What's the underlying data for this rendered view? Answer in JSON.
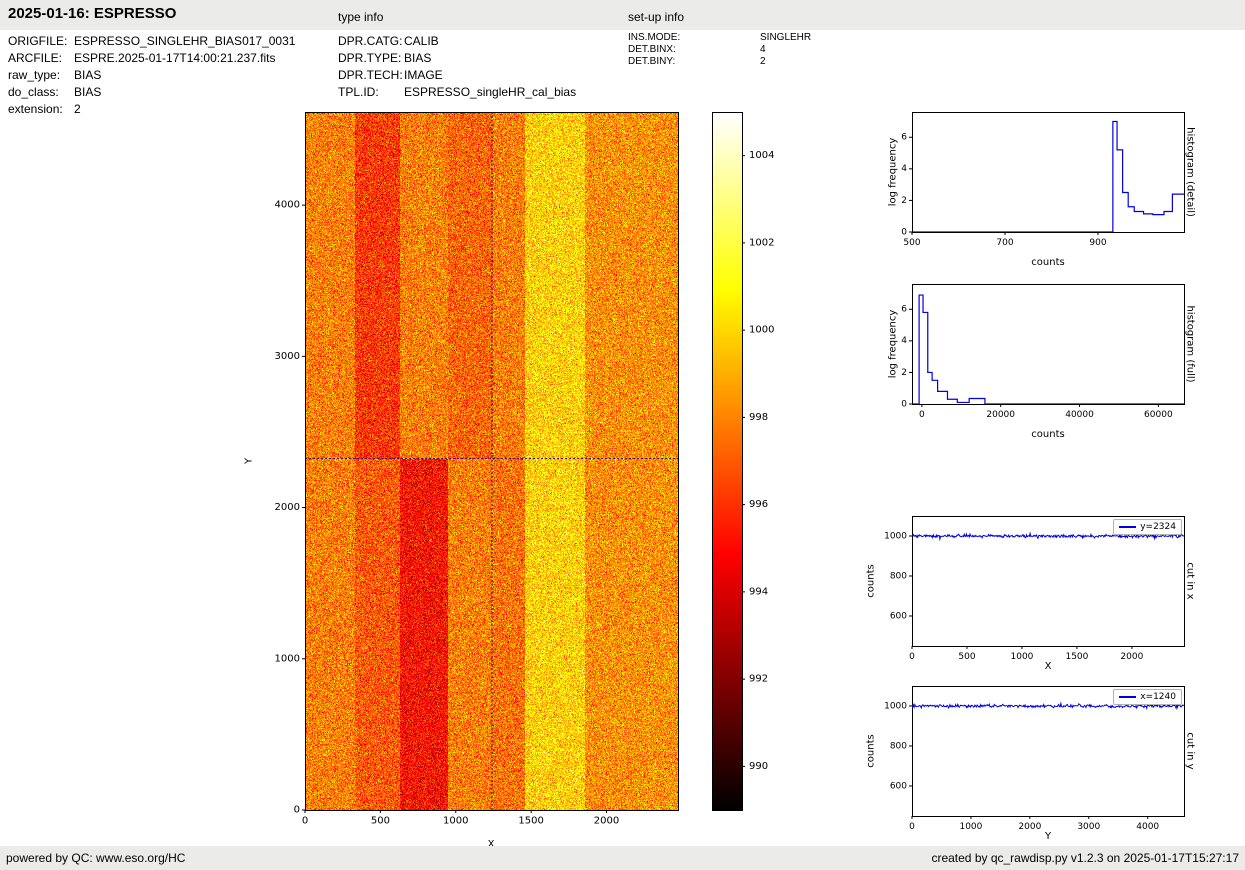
{
  "header": {
    "title": "2025-01-16: ESPRESSO",
    "type_info_label": "type info",
    "setup_info_label": "set-up info"
  },
  "file_info": {
    "rows": [
      {
        "label": "ORIGFILE:",
        "value": "ESPRESSO_SINGLEHR_BIAS017_0031"
      },
      {
        "label": "ARCFILE:",
        "value": "ESPRE.2025-01-17T14:00:21.237.fits"
      },
      {
        "label": "raw_type:",
        "value": "BIAS"
      },
      {
        "label": "do_class:",
        "value": "BIAS"
      },
      {
        "label": "extension:",
        "value": "2"
      }
    ]
  },
  "type_info": {
    "rows": [
      {
        "label": "DPR.CATG:",
        "value": "CALIB"
      },
      {
        "label": "DPR.TYPE:",
        "value": "BIAS"
      },
      {
        "label": "DPR.TECH:",
        "value": "IMAGE"
      },
      {
        "label": "TPL.ID:",
        "value": "ESPRESSO_singleHR_cal_bias"
      }
    ]
  },
  "setup_info": {
    "rows": [
      {
        "label": "INS.MODE:",
        "value": "SINGLEHR"
      },
      {
        "label": "DET.BINX:",
        "value": "4"
      },
      {
        "label": "DET.BINY:",
        "value": "2"
      }
    ]
  },
  "footer": {
    "powered_prefix": "powered by QC: ",
    "powered_link": "www.eso.org/HC",
    "created": "created by qc_rawdisp.py v1.2.3 on 2025-01-17T15:27:17"
  },
  "colors": {
    "line": "#0000e0",
    "crosshair": "#14148c",
    "header_bg": "#ebebe9"
  },
  "chart_data": [
    {
      "id": "raw-bias-image",
      "type": "heatmap",
      "xlabel": "X",
      "ylabel": "Y",
      "xlim": [
        0,
        2474
      ],
      "ylim": [
        0,
        4616
      ],
      "xticks": [
        0,
        500,
        1000,
        1500,
        2000
      ],
      "yticks": [
        0,
        1000,
        2000,
        3000,
        4000
      ],
      "colormap": "hot",
      "vmin": 989,
      "vmax": 1005,
      "noise_sigma": 1.25,
      "split_y": 2324,
      "crosshair": {
        "x": 1240,
        "y": 2324
      },
      "bands_upper": [
        {
          "x0": 0,
          "x1": 330,
          "value": 997.9
        },
        {
          "x0": 330,
          "x1": 630,
          "value": 996.2
        },
        {
          "x0": 630,
          "x1": 950,
          "value": 997.9
        },
        {
          "x0": 950,
          "x1": 1250,
          "value": 997.3
        },
        {
          "x0": 1250,
          "x1": 1460,
          "value": 997.9
        },
        {
          "x0": 1460,
          "x1": 1860,
          "value": 999.9
        },
        {
          "x0": 1860,
          "x1": 2474,
          "value": 998.3
        }
      ],
      "bands_lower": [
        {
          "x0": 0,
          "x1": 330,
          "value": 997.9
        },
        {
          "x0": 330,
          "x1": 630,
          "value": 997.0
        },
        {
          "x0": 630,
          "x1": 950,
          "value": 995.2
        },
        {
          "x0": 950,
          "x1": 1250,
          "value": 997.9
        },
        {
          "x0": 1250,
          "x1": 1460,
          "value": 997.6
        },
        {
          "x0": 1460,
          "x1": 1860,
          "value": 999.9
        },
        {
          "x0": 1860,
          "x1": 2474,
          "value": 998.3
        }
      ],
      "colorbar": {
        "ticks": [
          990,
          992,
          994,
          996,
          998,
          1000,
          1002,
          1004
        ]
      }
    },
    {
      "id": "histogram-detail",
      "type": "histogram",
      "side_label": "histogram (detail)",
      "xlabel": "counts",
      "ylabel": "log frequency",
      "xlim": [
        500,
        1085
      ],
      "ylim": [
        0,
        7.6
      ],
      "xticks": [
        500,
        700,
        900
      ],
      "yticks": [
        0,
        2,
        4,
        6
      ],
      "edges": [
        500,
        932,
        941,
        953,
        965,
        978,
        998,
        1018,
        1042,
        1060,
        1085
      ],
      "heights": [
        0,
        7.0,
        5.2,
        2.5,
        1.6,
        1.3,
        1.15,
        1.1,
        1.3,
        2.4
      ]
    },
    {
      "id": "histogram-full",
      "type": "histogram",
      "side_label": "histogram (full)",
      "xlabel": "counts",
      "ylabel": "log frequency",
      "xlim": [
        -2500,
        66500
      ],
      "ylim": [
        0,
        7.6
      ],
      "xticks": [
        0,
        20000,
        40000,
        60000
      ],
      "yticks": [
        0,
        2,
        4,
        6
      ],
      "edges": [
        -2500,
        -700,
        300,
        1500,
        2600,
        4000,
        6500,
        9000,
        12000,
        16000,
        66500
      ],
      "heights": [
        0,
        6.9,
        5.8,
        2.0,
        1.5,
        0.8,
        0.3,
        0.1,
        0.35,
        0
      ]
    },
    {
      "id": "cut-in-x",
      "type": "line",
      "side_label": "cut in x",
      "xlabel": "X",
      "ylabel": "counts",
      "xlim": [
        0,
        2474
      ],
      "ylim": [
        450,
        1100
      ],
      "xticks": [
        0,
        500,
        1000,
        1500,
        2000
      ],
      "yticks": [
        600,
        800,
        1000
      ],
      "legend": "y=2324",
      "baseline": 1000,
      "noise_sigma": 4
    },
    {
      "id": "cut-in-y",
      "type": "line",
      "side_label": "cut in y",
      "xlabel": "Y",
      "ylabel": "counts",
      "xlim": [
        0,
        4616
      ],
      "ylim": [
        450,
        1100
      ],
      "xticks": [
        0,
        1000,
        2000,
        3000,
        4000
      ],
      "yticks": [
        600,
        800,
        1000
      ],
      "legend": "x=1240",
      "baseline": 1000,
      "noise_sigma": 4
    }
  ]
}
